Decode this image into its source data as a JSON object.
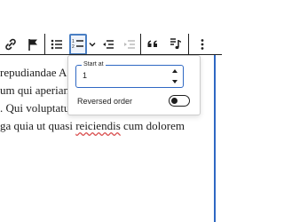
{
  "toolbar": {
    "buttons": [
      {
        "name": "link-icon",
        "label": "link"
      },
      {
        "name": "flag-icon",
        "label": "flag"
      },
      {
        "name": "unordered-list-icon",
        "label": "unordered list"
      },
      {
        "name": "ordered-list-icon",
        "label": "ordered list",
        "state": "active"
      },
      {
        "name": "chevron-down-icon",
        "label": "list options"
      },
      {
        "name": "outdent-icon",
        "label": "outdent"
      },
      {
        "name": "indent-icon",
        "label": "indent",
        "state": "disabled"
      },
      {
        "name": "quote-icon",
        "label": "quote"
      },
      {
        "name": "music-note-icon",
        "label": "music"
      },
      {
        "name": "more-vertical-icon",
        "label": "more options"
      }
    ]
  },
  "document": {
    "lines": [
      {
        "prefix": "repudiandae A",
        "spell": "",
        "suffix": ""
      },
      {
        "prefix": "um qui aperian",
        "spell": "",
        "suffix": ""
      },
      {
        "prefix": ". Qui voluptatu",
        "spell": "",
        "suffix": ""
      },
      {
        "prefix": "ga quia ut quasi ",
        "spell": "reiciendis",
        "suffix": " cum dolorem"
      }
    ]
  },
  "popover": {
    "start_at": {
      "label": "Start at",
      "value": "1"
    },
    "reversed": {
      "label": "Reversed order",
      "enabled": false
    }
  },
  "colors": {
    "accent": "#2f68c3",
    "text": "#1e1e1e",
    "disabled": "#bbbbbb",
    "spellcheck": "#d94f4f"
  }
}
